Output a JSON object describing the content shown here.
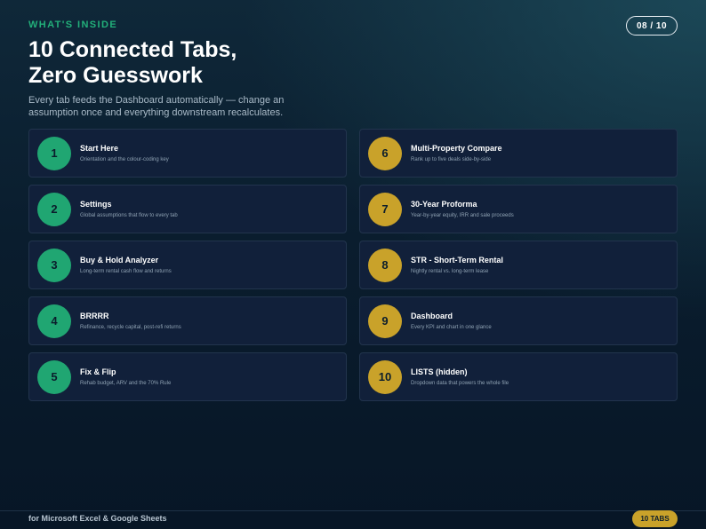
{
  "header": {
    "eyebrow": "WHAT'S INSIDE",
    "page_indicator": "08 / 10",
    "title_line1": "10 Connected Tabs,",
    "title_line2": "Zero Guesswork",
    "subtitle": "Every tab feeds the Dashboard automatically — change an assumption once and everything downstream recalculates."
  },
  "tabs": [
    {
      "number": "1",
      "title": "Start Here",
      "description": "Orientation and the colour-coding key"
    },
    {
      "number": "2",
      "title": "Settings",
      "description": "Global assumptions that flow to every tab"
    },
    {
      "number": "3",
      "title": "Buy & Hold Analyzer",
      "description": "Long-term rental cash flow and returns"
    },
    {
      "number": "4",
      "title": "BRRRR",
      "description": "Refinance, recycle capital, post-refi returns"
    },
    {
      "number": "5",
      "title": "Fix & Flip",
      "description": "Rehab budget, ARV and the 70% Rule"
    },
    {
      "number": "6",
      "title": "Multi-Property Compare",
      "description": "Rank up to five deals side-by-side"
    },
    {
      "number": "7",
      "title": "30-Year Proforma",
      "description": "Year-by-year equity, IRR and sale proceeds"
    },
    {
      "number": "8",
      "title": "STR - Short-Term Rental",
      "description": "Nightly rental vs. long-term lease"
    },
    {
      "number": "9",
      "title": "Dashboard",
      "description": "Every KPI and chart in one glance"
    },
    {
      "number": "10",
      "title": "LISTS (hidden)",
      "description": "Dropdown data that powers the whole file"
    }
  ],
  "footer": {
    "text": "for Microsoft Excel & Google Sheets",
    "badge": "10 TABS"
  },
  "colors": {
    "accent_green": "#20a672",
    "accent_gold": "#c9a22a",
    "background": "#0a1d2e"
  }
}
